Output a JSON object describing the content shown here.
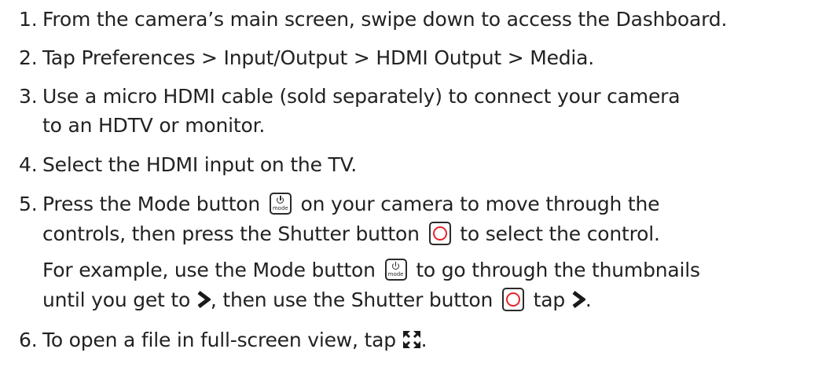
{
  "steps": [
    {
      "number": "1.",
      "lines": [
        "From the camera’s main screen, swipe down to access the Dashboard."
      ]
    },
    {
      "number": "2.",
      "lines": [
        "Tap Preferences > Input/Output > HDMI Output > Media."
      ]
    },
    {
      "number": "3.",
      "lines": [
        "Use a micro HDMI cable (sold separately) to connect your camera",
        "to an HDTV or monitor."
      ]
    },
    {
      "number": "4.",
      "lines": [
        "Select the HDMI input on the TV."
      ]
    },
    {
      "number": "5.",
      "line1": {
        "before": "Press the Mode button",
        "after": "on your camera to move through the"
      },
      "line2": {
        "before": "controls, then press the Shutter button",
        "after": "to select the control."
      },
      "example1": {
        "before": "For example, use the Mode button",
        "after": "to go through the thumbnails"
      },
      "example2": {
        "before": "until you get to",
        "middle": ", then use the Shutter button",
        "middle2": "tap",
        "after": "."
      }
    },
    {
      "number": "6.",
      "line1": {
        "before": "To open a file in full-screen view, tap",
        "after": "."
      }
    }
  ],
  "icons": {
    "mode_button": {
      "name": "mode-button-icon",
      "label": "mode"
    },
    "shutter_button": {
      "name": "shutter-button-icon",
      "ring_color": "#e4252b"
    },
    "chevron": {
      "name": "chevron-right-icon"
    },
    "fullscreen": {
      "name": "fullscreen-expand-icon"
    }
  },
  "colors": {
    "text": "#222222",
    "shutter_accent": "#e4252b"
  }
}
